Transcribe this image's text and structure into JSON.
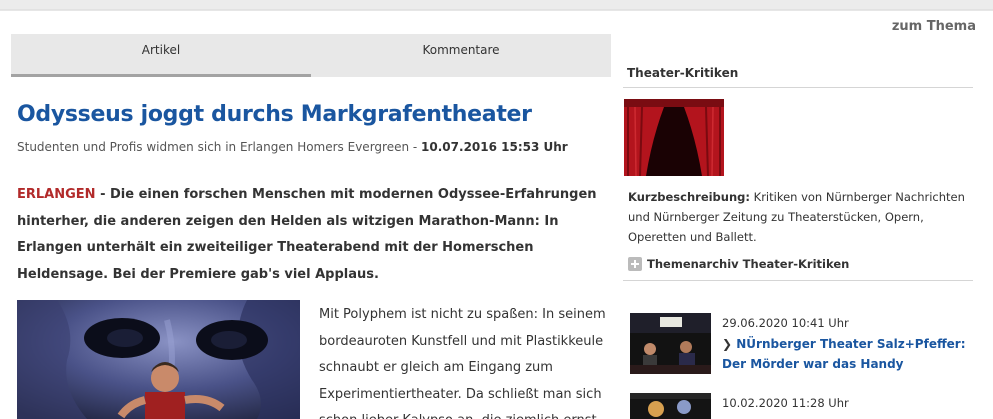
{
  "header": {
    "zum_thema": "zum Thema"
  },
  "tabs": [
    {
      "label": "Artikel",
      "active": true
    },
    {
      "label": "Kommentare",
      "active": false
    }
  ],
  "article": {
    "headline": "Odysseus joggt durchs Markgrafentheater",
    "subline": "Studenten und Profis widmen sich in Erlangen Homers Evergreen",
    "subline_sep": " - ",
    "datetime": "10.07.2016 15:53 Uhr",
    "place": "ERLANGEN",
    "lead": " - Die einen forschen Menschen mit modernen Odyssee-Erfahrungen hinterher, die anderen zeigen den Helden als witzigen Marathon-Mann: In Erlangen unterhält ein zweiteiliger Theaterabend mit der Homerschen Heldensage. Bei der Premiere gab's viel Applaus.",
    "body": "Mit Polyphem ist nicht zu spaßen: In seinem bordeauroten Kunstfell und mit Plastikkeule schnaubt er gleich am Eingang zum Experimentiertheater. Da schließt man sich schon lieber Kalypso an, die ziemlich ernst"
  },
  "sidebar": {
    "title": "Theater-Kritiken",
    "desc_label": "Kurzbeschreibung:",
    "desc_text": " Kritiken von Nürnberger Nachrichten und Nürnberger Zeitung zu Theaterstücken, Opern, Operetten und Ballett.",
    "archive_link": "Themenarchiv Theater-Kritiken",
    "news": [
      {
        "date": "29.06.2020 10:41 Uhr",
        "title": "NÜrnberger Theater Salz+Pfeffer: Der Mörder war das Handy"
      },
      {
        "date": "10.02.2020 11:28 Uhr",
        "title": ""
      }
    ]
  },
  "colors": {
    "link_blue": "#1a56a0",
    "place_red": "#b22a2a",
    "tab_bg": "#e8e8e8"
  }
}
